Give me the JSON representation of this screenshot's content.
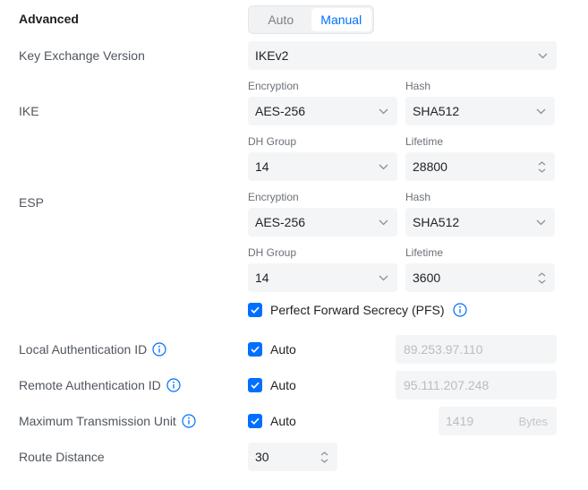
{
  "section": {
    "title": "Advanced"
  },
  "mode": {
    "options": [
      "Auto",
      "Manual"
    ],
    "selected": "Manual"
  },
  "key_exchange": {
    "label": "Key Exchange Version",
    "value": "IKEv2"
  },
  "ike": {
    "label": "IKE",
    "encryption": {
      "label": "Encryption",
      "value": "AES-256"
    },
    "hash": {
      "label": "Hash",
      "value": "SHA512"
    },
    "dh_group": {
      "label": "DH Group",
      "value": "14"
    },
    "lifetime": {
      "label": "Lifetime",
      "value": "28800"
    }
  },
  "esp": {
    "label": "ESP",
    "encryption": {
      "label": "Encryption",
      "value": "AES-256"
    },
    "hash": {
      "label": "Hash",
      "value": "SHA512"
    },
    "dh_group": {
      "label": "DH Group",
      "value": "14"
    },
    "lifetime": {
      "label": "Lifetime",
      "value": "3600"
    },
    "pfs": {
      "label": "Perfect Forward Secrecy (PFS)",
      "checked": true
    }
  },
  "local_auth": {
    "label": "Local Authentication ID",
    "auto_label": "Auto",
    "auto_checked": true,
    "placeholder": "89.253.97.110"
  },
  "remote_auth": {
    "label": "Remote Authentication ID",
    "auto_label": "Auto",
    "auto_checked": true,
    "placeholder": "95.111.207.248"
  },
  "mtu": {
    "label": "Maximum Transmission Unit",
    "auto_label": "Auto",
    "auto_checked": true,
    "placeholder": "1419",
    "unit": "Bytes"
  },
  "route_distance": {
    "label": "Route Distance",
    "value": "30"
  },
  "colors": {
    "accent": "#006fff",
    "field_bg": "#f4f5f6",
    "label": "#50565e",
    "disabled_text": "#b9bdc3"
  }
}
